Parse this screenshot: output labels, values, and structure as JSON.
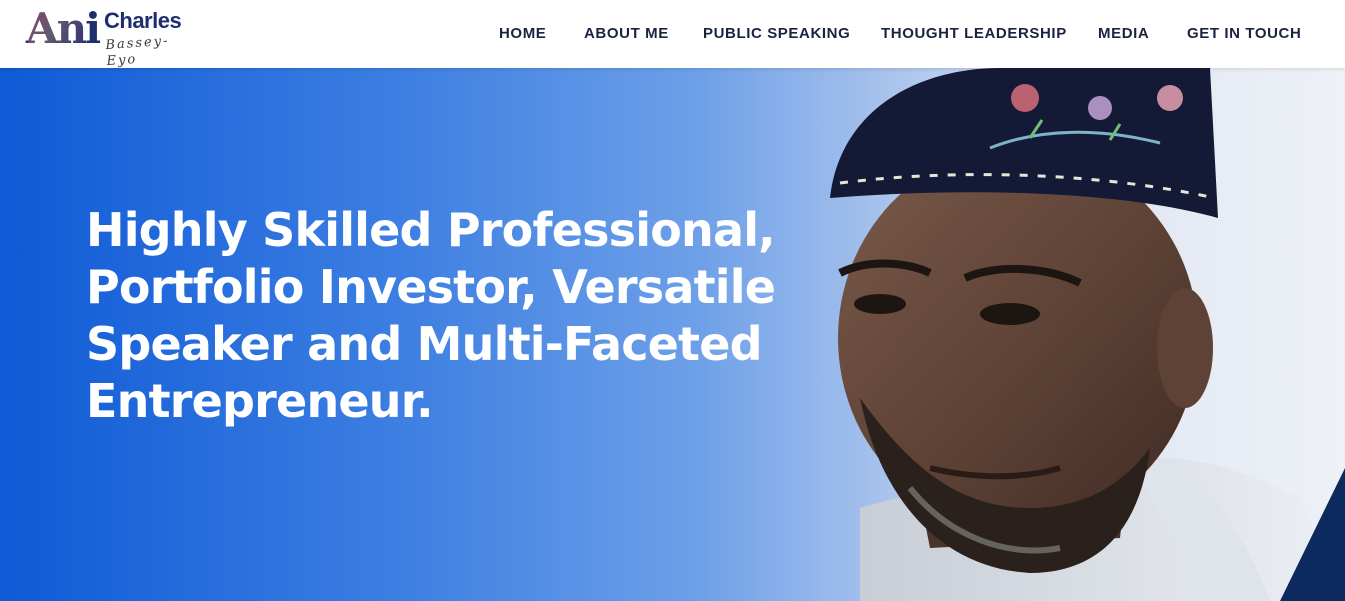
{
  "brand": {
    "logo_mark": "Ani",
    "logo_name": "Charles",
    "logo_surname": "Bassey-Eyo",
    "colors": {
      "navy": "#1d2f6f",
      "accent": "#cf5638"
    }
  },
  "nav": {
    "items": [
      {
        "label": "HOME"
      },
      {
        "label": "ABOUT ME"
      },
      {
        "label": "PUBLIC SPEAKING"
      },
      {
        "label": "THOUGHT LEADERSHIP"
      },
      {
        "label": "MEDIA"
      },
      {
        "label": "GET IN TOUCH"
      }
    ],
    "text_color": "#1a2340"
  },
  "hero": {
    "headline_lines": [
      "Highly Skilled Professional,",
      "Portfolio Investor, Versatile",
      "Speaker and Multi-Faceted",
      "Entrepreneur."
    ],
    "gradient": [
      "#0f5ad6",
      "#eef1f6"
    ],
    "corner_accent_color": "#0d2a5e"
  }
}
